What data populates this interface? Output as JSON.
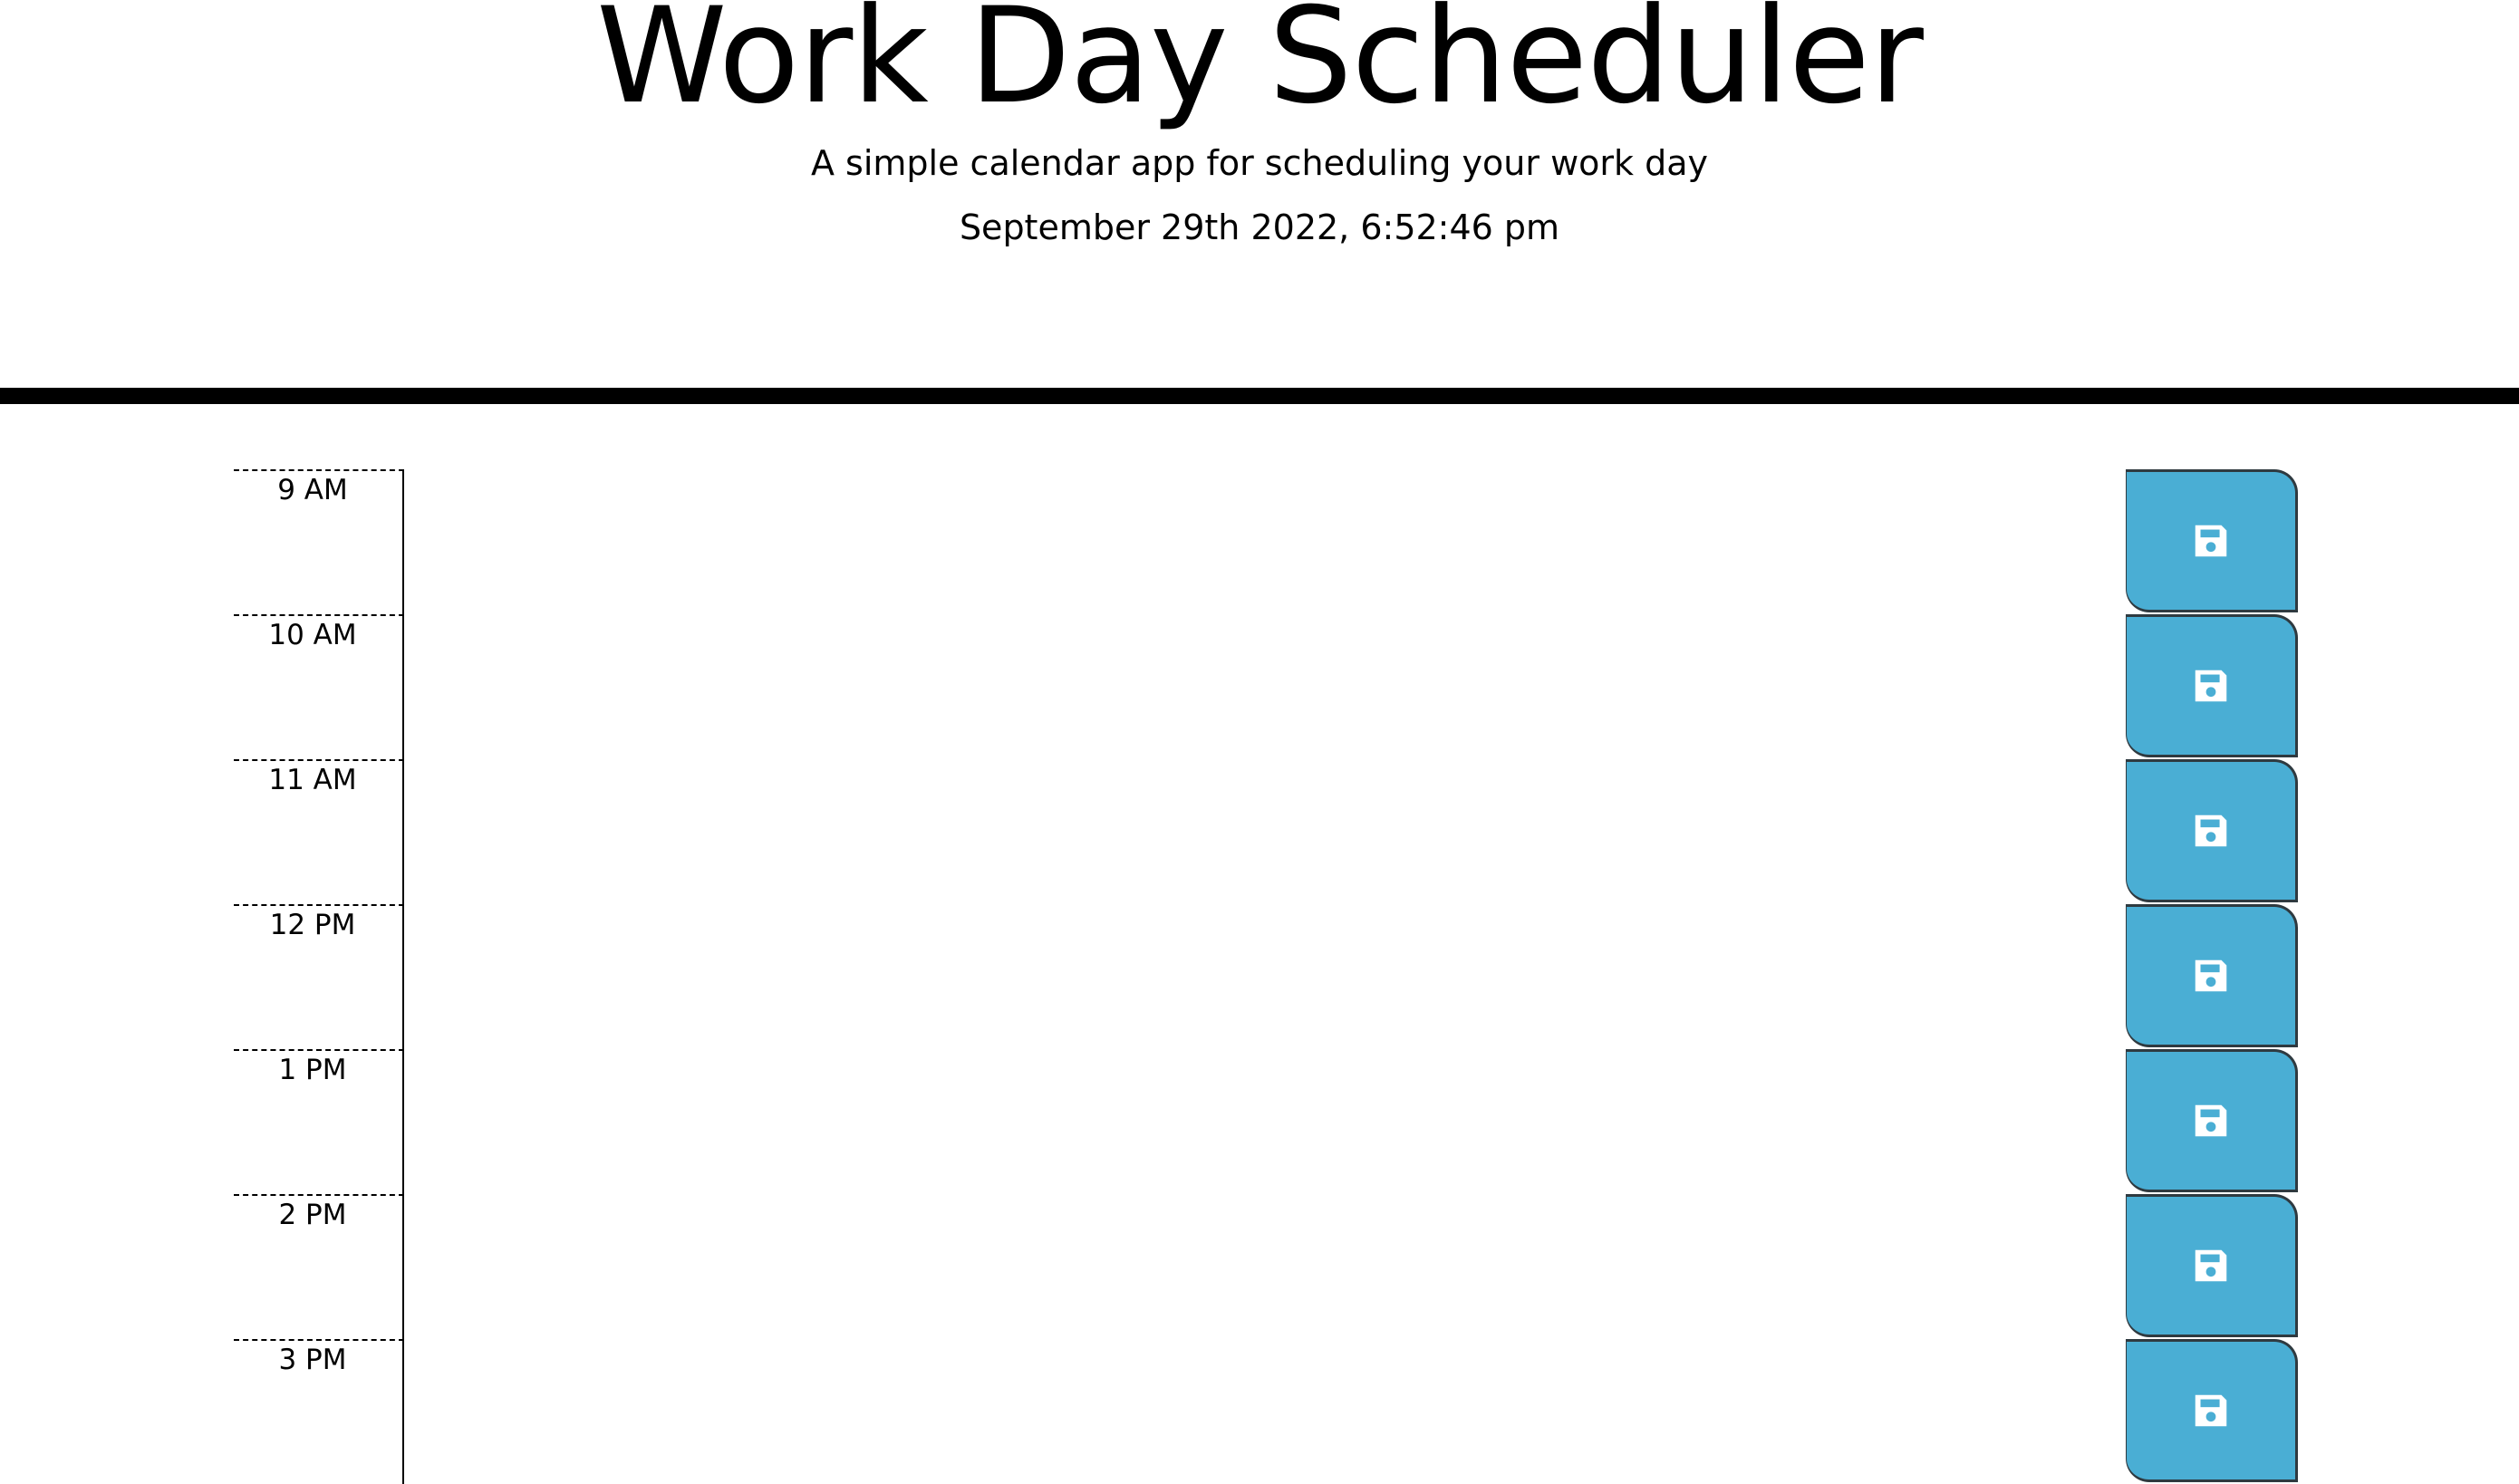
{
  "header": {
    "title": "Work Day Scheduler",
    "subtitle": "A simple calendar app for scheduling your work day",
    "current_datetime": "September 29th 2022, 6:52:46 pm"
  },
  "schedule": {
    "rows": [
      {
        "hour": "9 AM",
        "text": ""
      },
      {
        "hour": "10 AM",
        "text": ""
      },
      {
        "hour": "11 AM",
        "text": ""
      },
      {
        "hour": "12 PM",
        "text": ""
      },
      {
        "hour": "1 PM",
        "text": ""
      },
      {
        "hour": "2 PM",
        "text": ""
      },
      {
        "hour": "3 PM",
        "text": ""
      }
    ],
    "save_icon": "floppy-disk-icon"
  },
  "colors": {
    "save_button": "#4aaed4",
    "save_icon": "#ffffff",
    "divider": "#000000"
  }
}
